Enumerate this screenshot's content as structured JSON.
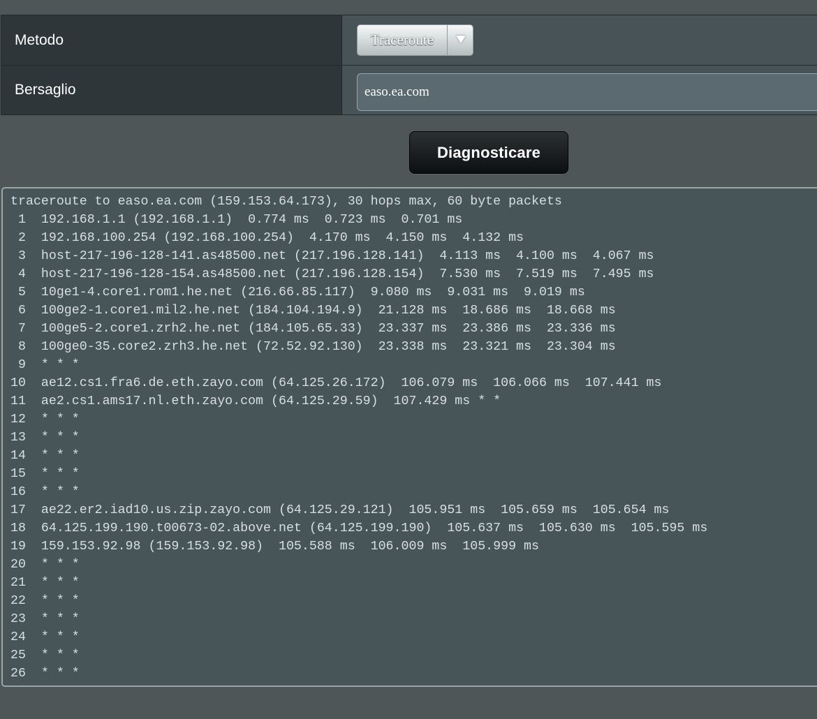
{
  "form": {
    "method_label": "Metodo",
    "method_value": "Traceroute",
    "target_label": "Bersaglio",
    "target_value": "easo.ea.com"
  },
  "diagnose_button": "Diagnosticare",
  "output_lines": [
    "traceroute to easo.ea.com (159.153.64.173), 30 hops max, 60 byte packets",
    " 1  192.168.1.1 (192.168.1.1)  0.774 ms  0.723 ms  0.701 ms",
    " 2  192.168.100.254 (192.168.100.254)  4.170 ms  4.150 ms  4.132 ms",
    " 3  host-217-196-128-141.as48500.net (217.196.128.141)  4.113 ms  4.100 ms  4.067 ms",
    " 4  host-217-196-128-154.as48500.net (217.196.128.154)  7.530 ms  7.519 ms  7.495 ms",
    " 5  10ge1-4.core1.rom1.he.net (216.66.85.117)  9.080 ms  9.031 ms  9.019 ms",
    " 6  100ge2-1.core1.mil2.he.net (184.104.194.9)  21.128 ms  18.686 ms  18.668 ms",
    " 7  100ge5-2.core1.zrh2.he.net (184.105.65.33)  23.337 ms  23.386 ms  23.336 ms",
    " 8  100ge0-35.core2.zrh3.he.net (72.52.92.130)  23.338 ms  23.321 ms  23.304 ms",
    " 9  * * *",
    "10  ae12.cs1.fra6.de.eth.zayo.com (64.125.26.172)  106.079 ms  106.066 ms  107.441 ms",
    "11  ae2.cs1.ams17.nl.eth.zayo.com (64.125.29.59)  107.429 ms * *",
    "12  * * *",
    "13  * * *",
    "14  * * *",
    "15  * * *",
    "16  * * *",
    "17  ae22.er2.iad10.us.zip.zayo.com (64.125.29.121)  105.951 ms  105.659 ms  105.654 ms",
    "18  64.125.199.190.t00673-02.above.net (64.125.199.190)  105.637 ms  105.630 ms  105.595 ms",
    "19  159.153.92.98 (159.153.92.98)  105.588 ms  106.009 ms  105.999 ms",
    "20  * * *",
    "21  * * *",
    "22  * * *",
    "23  * * *",
    "24  * * *",
    "25  * * *",
    "26  * * *"
  ],
  "colors": {
    "background": "#4f5658",
    "label_cell": "#2f3639",
    "value_cell": "#475357",
    "output_bg": "#475559",
    "output_text": "#d9dfe0",
    "button_bg": "#111416"
  },
  "icons": {
    "select_arrow": "triangle-down-icon"
  }
}
